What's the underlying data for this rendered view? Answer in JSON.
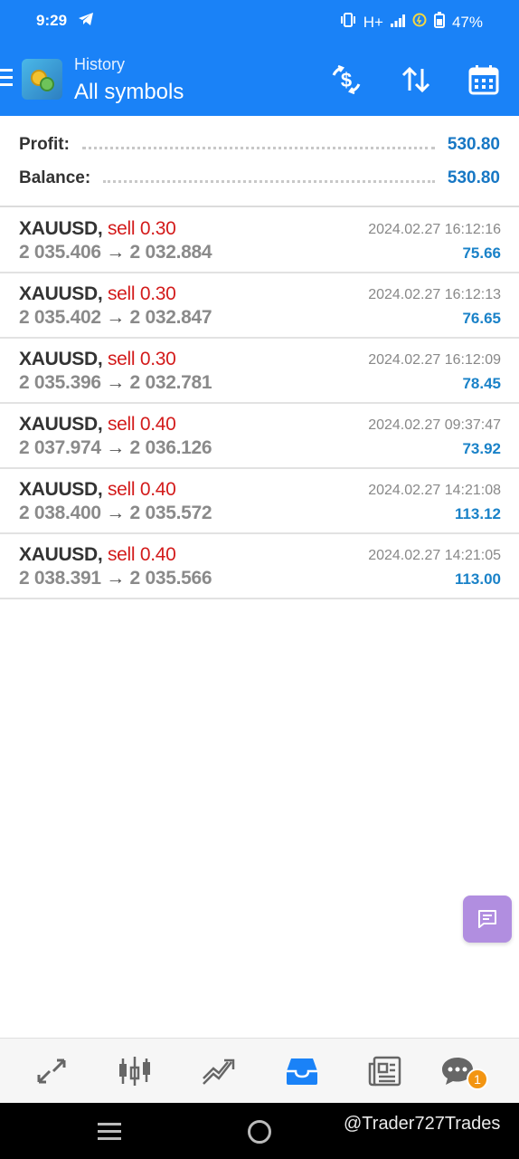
{
  "status_bar": {
    "time": "9:29",
    "network": "H+",
    "battery": "47%"
  },
  "app_bar": {
    "subtitle": "History",
    "title": "All symbols"
  },
  "summary": [
    {
      "label": "Profit:",
      "value": "530.80"
    },
    {
      "label": "Balance:",
      "value": "530.80"
    }
  ],
  "deals": [
    {
      "symbol": "XAUUSD,",
      "type": "sell 0.30",
      "open": "2 035.406",
      "arrow": "→",
      "close": "2 032.884",
      "time": "2024.02.27 16:12:16",
      "profit": "75.66"
    },
    {
      "symbol": "XAUUSD,",
      "type": "sell 0.30",
      "open": "2 035.402",
      "arrow": "→",
      "close": "2 032.847",
      "time": "2024.02.27 16:12:13",
      "profit": "76.65"
    },
    {
      "symbol": "XAUUSD,",
      "type": "sell 0.30",
      "open": "2 035.396",
      "arrow": "→",
      "close": "2 032.781",
      "time": "2024.02.27 16:12:09",
      "profit": "78.45"
    },
    {
      "symbol": "XAUUSD,",
      "type": "sell 0.40",
      "open": "2 037.974",
      "arrow": "→",
      "close": "2 036.126",
      "time": "2024.02.27 09:37:47",
      "profit": "73.92"
    },
    {
      "symbol": "XAUUSD,",
      "type": "sell 0.40",
      "open": "2 038.400",
      "arrow": "→",
      "close": "2 035.572",
      "time": "2024.02.27 14:21:08",
      "profit": "113.12"
    },
    {
      "symbol": "XAUUSD,",
      "type": "sell 0.40",
      "open": "2 038.391",
      "arrow": "→",
      "close": "2 035.566",
      "time": "2024.02.27 14:21:05",
      "profit": "113.00"
    }
  ],
  "bottom_nav": {
    "items": [
      "quotes-icon",
      "chart-icon",
      "trade-icon",
      "history-icon",
      "news-icon",
      "chat-icon"
    ],
    "active": "history-icon",
    "chat_badge": "1"
  },
  "watermark": "@Trader727Trades",
  "colors": {
    "primary": "#1a82f7",
    "sell": "#d31b1b",
    "profit": "#1a82c8",
    "fab": "#b18ee0",
    "badge": "#f39512"
  }
}
